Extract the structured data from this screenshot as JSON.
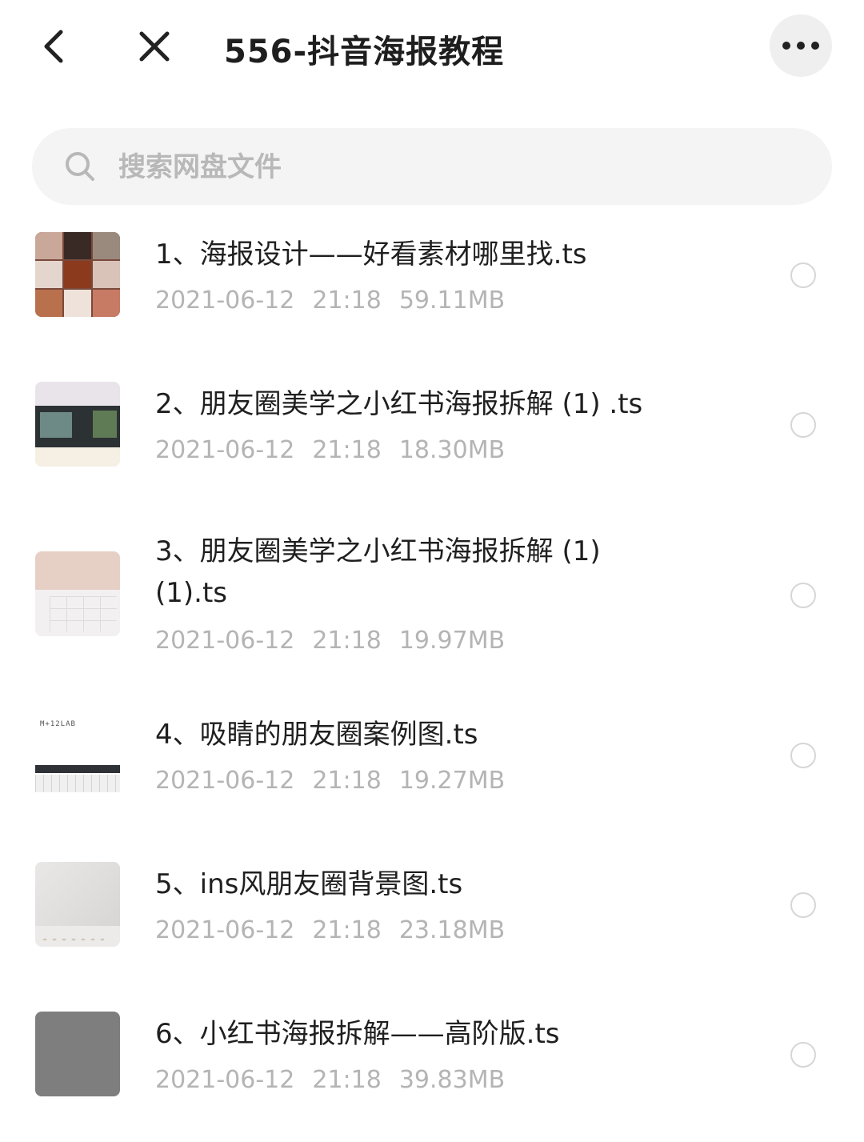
{
  "header": {
    "title": "556-抖音海报教程",
    "back_icon": "chevron-left-icon",
    "close_icon": "close-icon",
    "more_icon": "more-horizontal-icon"
  },
  "search": {
    "placeholder": "搜索网盘文件",
    "icon": "search-icon"
  },
  "files": [
    {
      "name": "1、海报设计——好看素材哪里找.ts",
      "date": "2021-06-12",
      "time": "21:18",
      "size": "59.11MB"
    },
    {
      "name": "2、朋友圈美学之小红书海报拆解 (1) .ts",
      "date": "2021-06-12",
      "time": "21:18",
      "size": "18.30MB"
    },
    {
      "name": "3、朋友圈美学之小红书海报拆解 (1)(1).ts",
      "date": "2021-06-12",
      "time": "21:18",
      "size": "19.97MB"
    },
    {
      "name": "4、吸睛的朋友圈案例图.ts",
      "date": "2021-06-12",
      "time": "21:18",
      "size": "19.27MB",
      "thumb_text": "M+12LAB"
    },
    {
      "name": "5、ins风朋友圈背景图.ts",
      "date": "2021-06-12",
      "time": "21:18",
      "size": "23.18MB"
    },
    {
      "name": "6、小红书海报拆解——高阶版.ts",
      "date": "2021-06-12",
      "time": "21:18",
      "size": "39.83MB"
    }
  ],
  "colors": {
    "title": "#1e1e1e",
    "meta": "#b4b4b4",
    "search_bg": "#f4f4f4",
    "circle_border": "#d6d6d6"
  }
}
